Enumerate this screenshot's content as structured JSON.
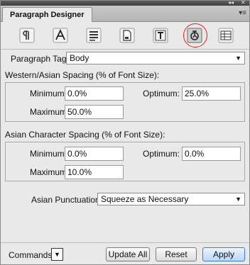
{
  "panel": {
    "title": "Paragraph Designer",
    "collapse_glyph": "◂◂",
    "close_glyph": "✕",
    "menu_glyph": "▾≡"
  },
  "toolbar": {
    "icons": [
      {
        "name": "pilcrow-icon",
        "state": "normal"
      },
      {
        "name": "font-a-icon",
        "state": "normal"
      },
      {
        "name": "paragraph-lines-icon",
        "state": "normal"
      },
      {
        "name": "page-document-icon",
        "state": "normal"
      },
      {
        "name": "text-frame-t-icon",
        "state": "normal"
      },
      {
        "name": "asian-character-icon",
        "state": "selected",
        "highlight_color": "#e02020"
      },
      {
        "name": "table-grid-icon",
        "state": "normal"
      }
    ]
  },
  "paragraph_tag": {
    "label": "Paragraph Tag:",
    "value": "Body"
  },
  "western_asian_spacing": {
    "heading": "Western/Asian Spacing (% of Font Size):",
    "minimum_label": "Minimum:",
    "minimum_value": "0.0%",
    "optimum_label": "Optimum:",
    "optimum_value": "25.0%",
    "maximum_label": "Maximum:",
    "maximum_value": "50.0%"
  },
  "asian_character_spacing": {
    "heading": "Asian Character Spacing (% of Font Size):",
    "minimum_label": "Minimum:",
    "minimum_value": "0.0%",
    "optimum_label": "Optimum:",
    "optimum_value": "0.0%",
    "maximum_label": "Maximum:",
    "maximum_value": "10.0%"
  },
  "asian_punctuation": {
    "label": "Asian Punctuation:",
    "value": "Squeeze as Necessary"
  },
  "footer": {
    "commands_label": "Commands:",
    "update_all_label": "Update All",
    "reset_label": "Reset",
    "apply_label": "Apply"
  }
}
